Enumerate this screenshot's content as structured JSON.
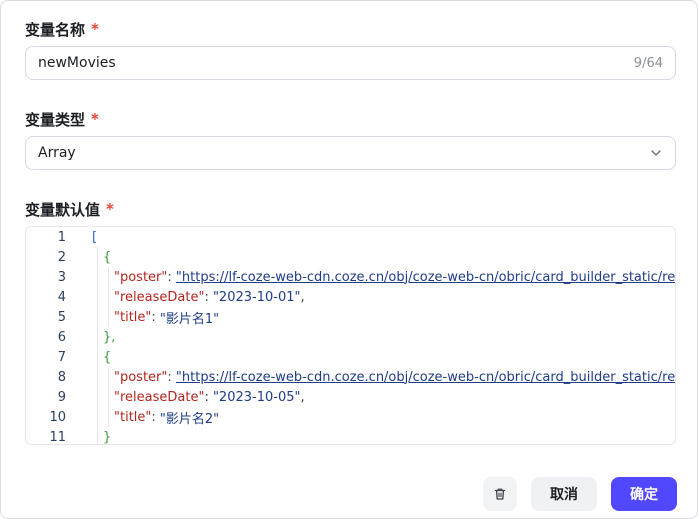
{
  "name_field": {
    "label": "变量名称",
    "required_mark": "*",
    "value": "newMovies",
    "counter": "9/64"
  },
  "type_field": {
    "label": "变量类型",
    "required_mark": "*",
    "value": "Array",
    "icon": "chevron-down-icon"
  },
  "default_field": {
    "label": "变量默认值",
    "required_mark": "*",
    "lines": [
      {
        "n": "1"
      },
      {
        "n": "2"
      },
      {
        "n": "3",
        "key": "\"poster\"",
        "url": "\"https://lf-coze-web-cdn.coze.cn/obj/coze-web-cn/obric/card_builder_static/re"
      },
      {
        "n": "4",
        "key": "\"releaseDate\"",
        "str": "\"2023-10-01\""
      },
      {
        "n": "5",
        "key": "\"title\"",
        "str": "\"影片名1\""
      },
      {
        "n": "6"
      },
      {
        "n": "7"
      },
      {
        "n": "8",
        "key": "\"poster\"",
        "url": "\"https://lf-coze-web-cdn.coze.cn/obj/coze-web-cn/obric/card_builder_static/re"
      },
      {
        "n": "9",
        "key": "\"releaseDate\"",
        "str": "\"2023-10-05\""
      },
      {
        "n": "10",
        "key": "\"title\"",
        "str": "\"影片名2\""
      },
      {
        "n": "11"
      }
    ],
    "punct": {
      "open_bracket": "[",
      "open_brace": "{",
      "close_brace": "}",
      "close_brace_comma": "},",
      "colon": ": ",
      "comma": ","
    }
  },
  "footer": {
    "delete_icon": "trash-icon",
    "cancel_label": "取消",
    "confirm_label": "确定"
  },
  "colors": {
    "primary": "#5147ff",
    "required": "#e5483b",
    "json_key": "#b3261e",
    "json_string": "#1f3c88"
  }
}
